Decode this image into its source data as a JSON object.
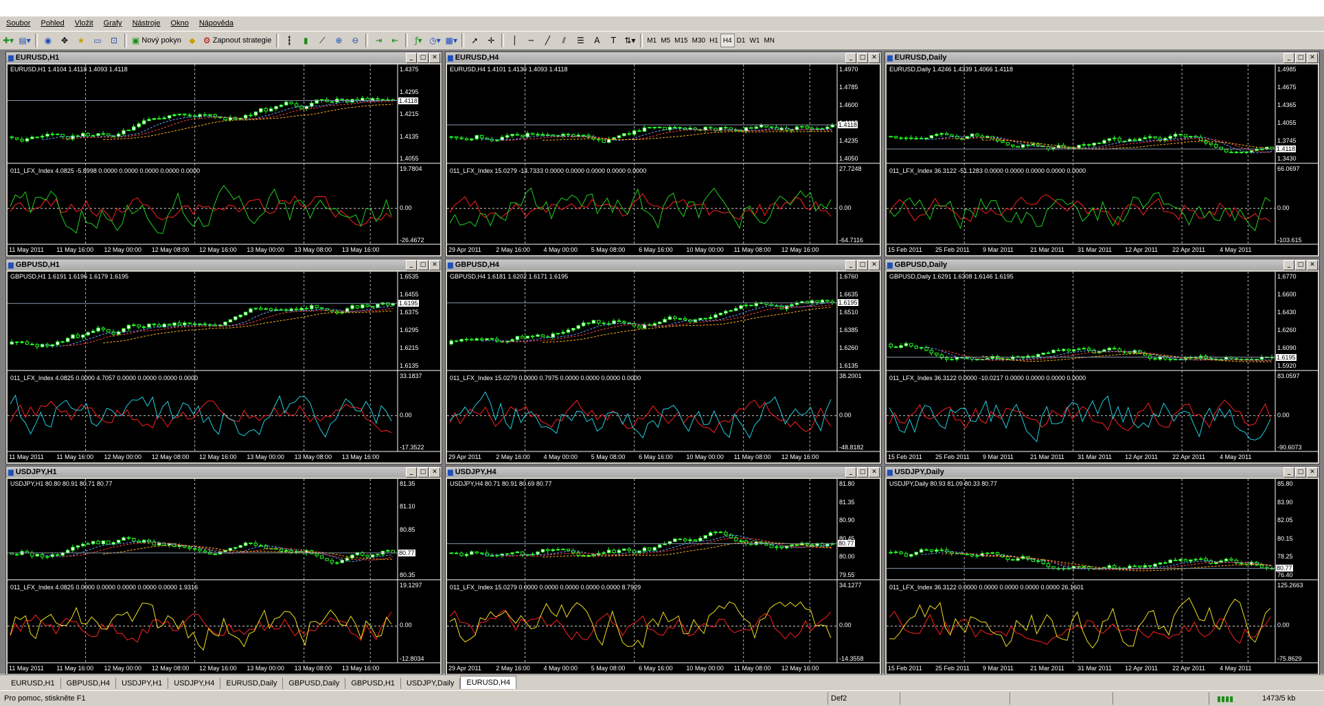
{
  "menu": [
    "Soubor",
    "Pohled",
    "Vložit",
    "Grafy",
    "Nástroje",
    "Okno",
    "Nápověda"
  ],
  "toolbar": {
    "new_order": "Nový pokyn",
    "strategies": "Zapnout strategie",
    "timeframes": [
      "M1",
      "M5",
      "M15",
      "M30",
      "H1",
      "H4",
      "D1",
      "W1",
      "MN"
    ],
    "active_timeframe": "H4"
  },
  "charts": [
    {
      "title": "EURUSD,H1",
      "ohlc": "EURUSD,H1  1.4104 1.4118 1.4093 1.4118",
      "indicator": "011_LFX_Index 4.0825 -5.8998 0.0000 0.0000 0.0000 0.0000 0.0000",
      "price_ticks": [
        "1.4375",
        "1.4295",
        "1.4215",
        "1.4135",
        "1.4055"
      ],
      "price_tag": "1.4118",
      "ind_ticks": [
        "19.7804",
        "0.00",
        "-26.4672"
      ],
      "time_ticks": [
        "11 May 2011",
        "11 May 16:00",
        "12 May 00:00",
        "12 May 08:00",
        "12 May 16:00",
        "13 May 00:00",
        "13 May 08:00",
        "13 May 16:00"
      ],
      "ind_colors": [
        "#ff2020",
        "#20d020"
      ]
    },
    {
      "title": "EURUSD,H4",
      "ohlc": "EURUSD,H4  1.4101 1.4130 1.4093 1.4118",
      "indicator": "011_LFX_Index 15.0279 -14.7333 0.0000 0.0000 0.0000 0.0000 0.0000",
      "price_ticks": [
        "1.4970",
        "1.4785",
        "1.4600",
        "1.4415",
        "1.4235",
        "1.4050"
      ],
      "price_tag": "1.4118",
      "ind_ticks": [
        "27.7248",
        "0.00",
        "-64.7116"
      ],
      "time_ticks": [
        "29 Apr 2011",
        "2 May 16:00",
        "4 May 00:00",
        "5 May 08:00",
        "6 May 16:00",
        "10 May 00:00",
        "11 May 08:00",
        "12 May 16:00"
      ],
      "ind_colors": [
        "#ff2020",
        "#20d020"
      ]
    },
    {
      "title": "EURUSD,Daily",
      "ohlc": "EURUSD,Daily  1.4246 1.4339 1.4066 1.4118",
      "indicator": "011_LFX_Index 36.3122 -51.1283 0.0000 0.0000 0.0000 0.0000 0.0000",
      "price_ticks": [
        "1.4985",
        "1.4675",
        "1.4365",
        "1.4055",
        "1.3745",
        "1.3430"
      ],
      "price_tag": "1.4118",
      "ind_ticks": [
        "66.0697",
        "0.00",
        "-103.615"
      ],
      "time_ticks": [
        "15 Feb 2011",
        "25 Feb 2011",
        "9 Mar 2011",
        "21 Mar 2011",
        "31 Mar 2011",
        "12 Apr 2011",
        "22 Apr 2011",
        "4 May 2011"
      ],
      "ind_colors": [
        "#ff2020",
        "#20d020"
      ]
    },
    {
      "title": "GBPUSD,H1",
      "ohlc": "GBPUSD,H1  1.6191 1.6196 1.6179 1.6195",
      "indicator": "011_LFX_Index 4.0825 0.0000 4.7057 0.0000 0.0000 0.0000 0.0000",
      "price_ticks": [
        "1.6535",
        "1.6455",
        "1.6375",
        "1.6295",
        "1.6215",
        "1.6135"
      ],
      "price_tag": "1.6195",
      "ind_ticks": [
        "33.1837",
        "0.00",
        "-17.3522"
      ],
      "time_ticks": [
        "11 May 2011",
        "11 May 16:00",
        "12 May 00:00",
        "12 May 08:00",
        "12 May 16:00",
        "13 May 00:00",
        "13 May 08:00",
        "13 May 16:00"
      ],
      "ind_colors": [
        "#ff2020",
        "#20d0e0"
      ]
    },
    {
      "title": "GBPUSD,H4",
      "ohlc": "GBPUSD,H4  1.6181 1.6202 1.6171 1.6195",
      "indicator": "011_LFX_Index 15.0279 0.0000 0.7975 0.0000 0.0000 0.0000 0.0000",
      "price_ticks": [
        "1.6760",
        "1.6635",
        "1.6510",
        "1.6385",
        "1.6260",
        "1.6135"
      ],
      "price_tag": "1.6195",
      "ind_ticks": [
        "38.2001",
        "0.00",
        "-48.8182"
      ],
      "time_ticks": [
        "29 Apr 2011",
        "2 May 16:00",
        "4 May 00:00",
        "5 May 08:00",
        "6 May 16:00",
        "10 May 00:00",
        "11 May 08:00",
        "12 May 16:00"
      ],
      "ind_colors": [
        "#ff2020",
        "#20d0e0"
      ]
    },
    {
      "title": "GBPUSD,Daily",
      "ohlc": "GBPUSD,Daily  1.6291 1.6308 1.6146 1.6195",
      "indicator": "011_LFX_Index 36.3122 0.0000 -10.0217 0.0000 0.0000 0.0000 0.0000",
      "price_ticks": [
        "1.6770",
        "1.6600",
        "1.6430",
        "1.6260",
        "1.6090",
        "1.5920"
      ],
      "price_tag": "1.6195",
      "ind_ticks": [
        "83.0597",
        "0.00",
        "-90.6073"
      ],
      "time_ticks": [
        "15 Feb 2011",
        "25 Feb 2011",
        "9 Mar 2011",
        "21 Mar 2011",
        "31 Mar 2011",
        "12 Apr 2011",
        "22 Apr 2011",
        "4 May 2011"
      ],
      "ind_colors": [
        "#ff2020",
        "#20d0e0"
      ]
    },
    {
      "title": "USDJPY,H1",
      "ohlc": "USDJPY,H1  80.80 80.91 80.71 80.77",
      "indicator": "011_LFX_Index 4.0825 0.0000 0.0000 0.0000 0.0000 0.0000 1.9316",
      "price_ticks": [
        "81.35",
        "81.10",
        "80.85",
        "80.60",
        "80.35"
      ],
      "price_tag": "80.77",
      "ind_ticks": [
        "19.1297",
        "0.00",
        "-12.8034"
      ],
      "time_ticks": [
        "11 May 2011",
        "11 May 16:00",
        "12 May 00:00",
        "12 May 08:00",
        "12 May 16:00",
        "13 May 00:00",
        "13 May 08:00",
        "13 May 16:00"
      ],
      "ind_colors": [
        "#ff2020",
        "#f0e020"
      ]
    },
    {
      "title": "USDJPY,H4",
      "ohlc": "USDJPY,H4  80.71 80.91 80.69 80.77",
      "indicator": "011_LFX_Index 15.0279 0.0000 0.0000 0.0000 0.0000 0.0000 8.7929",
      "price_ticks": [
        "81.80",
        "81.35",
        "80.90",
        "80.45",
        "80.00",
        "79.55"
      ],
      "price_tag": "80.77",
      "ind_ticks": [
        "34.1277",
        "0.00",
        "-14.3558"
      ],
      "time_ticks": [
        "29 Apr 2011",
        "2 May 16:00",
        "4 May 00:00",
        "5 May 08:00",
        "6 May 16:00",
        "10 May 00:00",
        "11 May 08:00",
        "12 May 16:00"
      ],
      "ind_colors": [
        "#ff2020",
        "#f0e020"
      ]
    },
    {
      "title": "USDJPY,Daily",
      "ohlc": "USDJPY,Daily  80.93 81.09 80.33 80.77",
      "indicator": "011_LFX_Index 36.3122 0.0000 0.0000 0.0000 0.0000 0.0000 26.1601",
      "price_ticks": [
        "85.80",
        "83.90",
        "82.05",
        "80.15",
        "78.25",
        "76.40"
      ],
      "price_tag": "80.77",
      "ind_ticks": [
        "125.2663",
        "0.00",
        "-75.8629"
      ],
      "time_ticks": [
        "15 Feb 2011",
        "25 Feb 2011",
        "9 Mar 2011",
        "21 Mar 2011",
        "31 Mar 2011",
        "12 Apr 2011",
        "22 Apr 2011",
        "4 May 2011"
      ],
      "ind_colors": [
        "#ff2020",
        "#f0e020"
      ]
    }
  ],
  "tabs": [
    "EURUSD,H1",
    "GBPUSD,H4",
    "USDJPY,H1",
    "USDJPY,H4",
    "EURUSD,Daily",
    "GBPUSD,Daily",
    "GBPUSD,H1",
    "USDJPY,Daily",
    "EURUSD,H4"
  ],
  "active_tab": "EURUSD,H4",
  "status": {
    "help": "Pro pomoc, stiskněte F1",
    "profile": "Def2",
    "traffic": "1473/5 kb"
  }
}
